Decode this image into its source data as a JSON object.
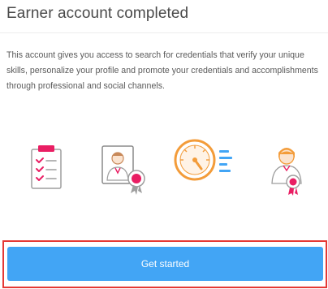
{
  "header": {
    "title": "Earner account completed"
  },
  "body": {
    "description": "This account gives you access to search for credentials that verify your unique skills, personalize your profile and promote your credentials and accomplishments through professional and social channels."
  },
  "illustrations": [
    {
      "icon": "checklist-icon"
    },
    {
      "icon": "profile-badge-icon"
    },
    {
      "icon": "gauge-icon"
    },
    {
      "icon": "person-medal-icon"
    }
  ],
  "cta": {
    "label": "Get started"
  },
  "colors": {
    "accent": "#42a5f5",
    "highlight": "#e53935",
    "orange": "#f39c3a",
    "pink": "#e91e63"
  }
}
